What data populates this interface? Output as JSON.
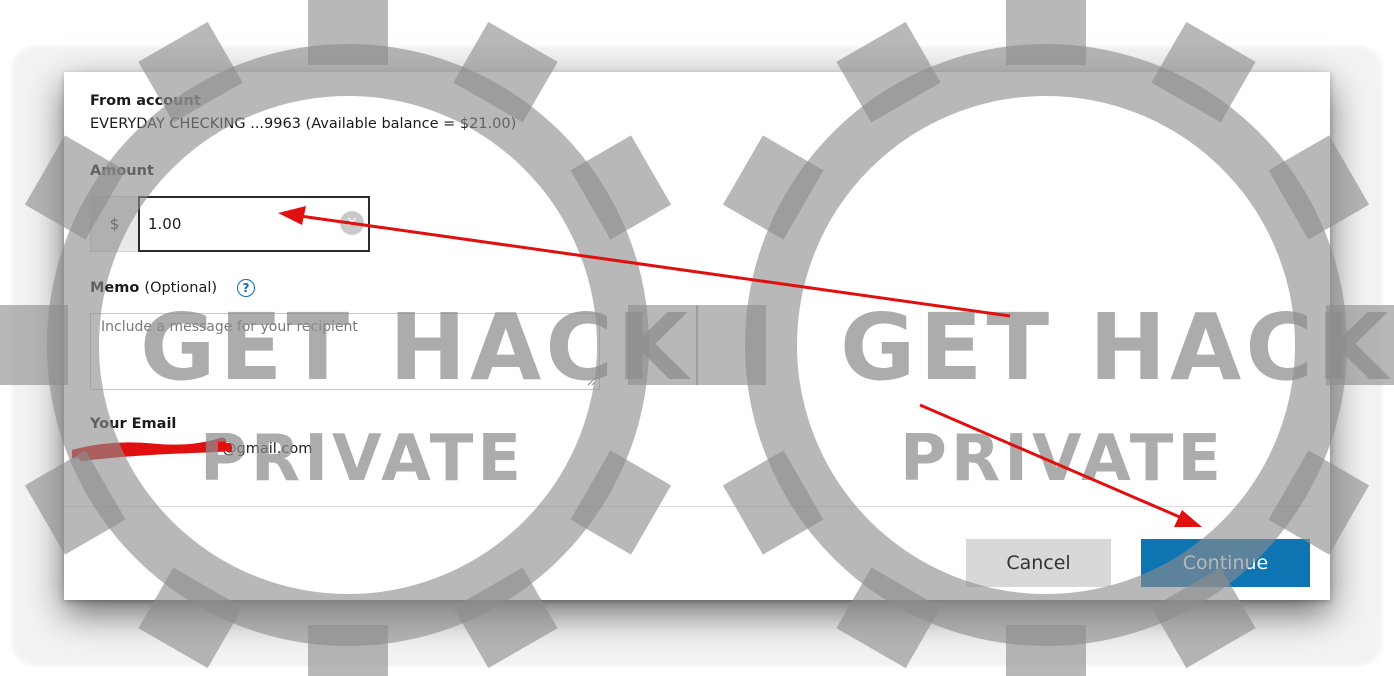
{
  "form": {
    "from_account_label": "From account",
    "from_account_value": "EVERYDAY CHECKING ...9963 (Available balance = $21.00)",
    "amount_label": "Amount",
    "currency_symbol": "$",
    "amount_value": "1.00",
    "memo_label": "Memo",
    "memo_optional": "(Optional)",
    "memo_help": "?",
    "memo_placeholder": "Include a message for your recipient",
    "email_label": "Your Email",
    "email_value": "@gmail.com"
  },
  "actions": {
    "cancel_label": "Cancel",
    "continue_label": "Continue"
  },
  "watermark": {
    "line1": "GET HACK",
    "line2": "PRIVATE"
  },
  "colors": {
    "primary_button": "#0f75b2",
    "secondary_button": "#d8d8d8",
    "annotation_arrow": "#e01010",
    "redaction": "#e01010"
  },
  "icons": [
    "clear-icon",
    "help-icon",
    "resize-handle-icon",
    "gear-watermark-icon",
    "arrow-annotation-icon"
  ]
}
